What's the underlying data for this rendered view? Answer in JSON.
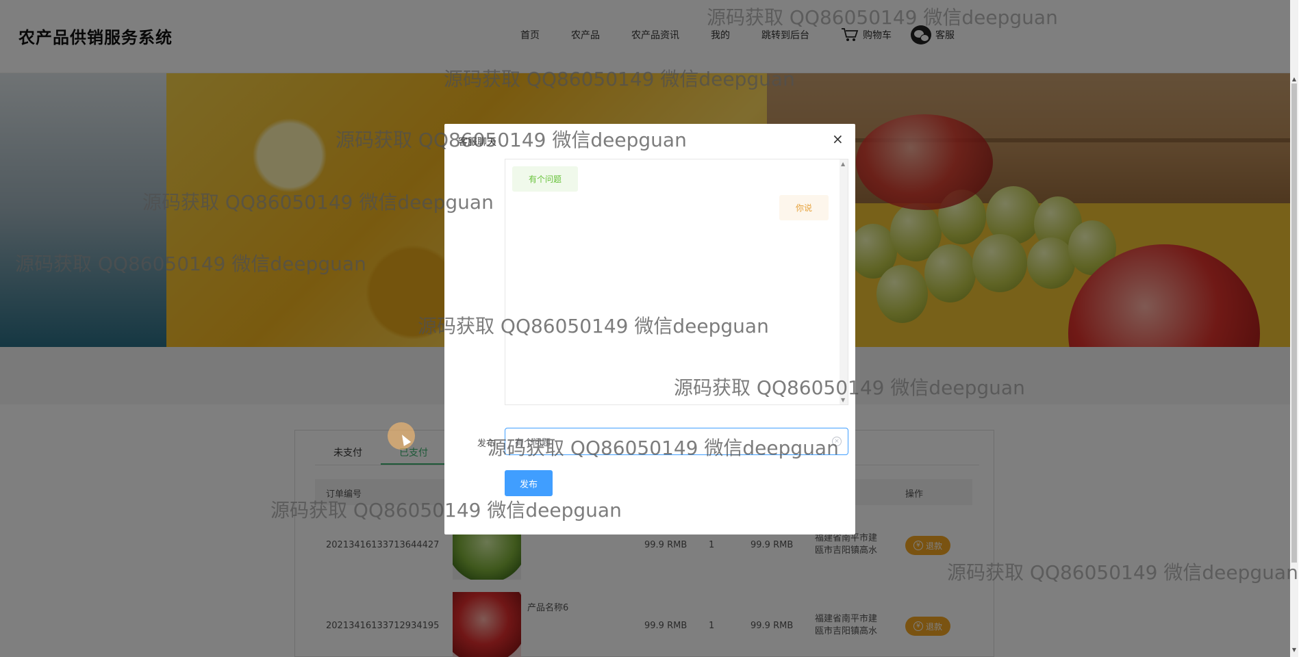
{
  "header": {
    "brand": "农产品供销服务系统",
    "nav": [
      "首页",
      "农产品",
      "农产品资讯",
      "我的",
      "跳转到后台"
    ],
    "cart_label": "购物车",
    "service_label": "客服"
  },
  "orders": {
    "tabs": [
      "未支付",
      "已支付"
    ],
    "active_tab": "已支付",
    "columns": {
      "order_no": "订单编号",
      "operation": "操作"
    },
    "rows": [
      {
        "order_no": "20213416133713644427",
        "name": "",
        "price": "99.9 RMB",
        "qty": "1",
        "total": "99.9 RMB",
        "address": "福建省南平市建瓯市吉阳镇高水",
        "refund": "退款",
        "image": "lettuce"
      },
      {
        "order_no": "20213416133712934195",
        "name": "产品名称6",
        "price": "99.9 RMB",
        "qty": "1",
        "total": "99.9 RMB",
        "address": "福建省南平市建瓯市吉阳镇高水",
        "refund": "退款",
        "image": "apple"
      }
    ]
  },
  "dialog": {
    "title": "客服聊天",
    "close": "×",
    "messages": [
      {
        "side": "left",
        "text": "有个问题"
      },
      {
        "side": "right",
        "text": "你说"
      }
    ],
    "send_label": "发布",
    "input_value": "有个问题",
    "submit": "发布"
  },
  "watermark": "源码获取 QQ86050149 微信deepguan",
  "colors": {
    "primary": "#409eff",
    "tab_active": "#3cb371",
    "refund": "#f5a623"
  }
}
